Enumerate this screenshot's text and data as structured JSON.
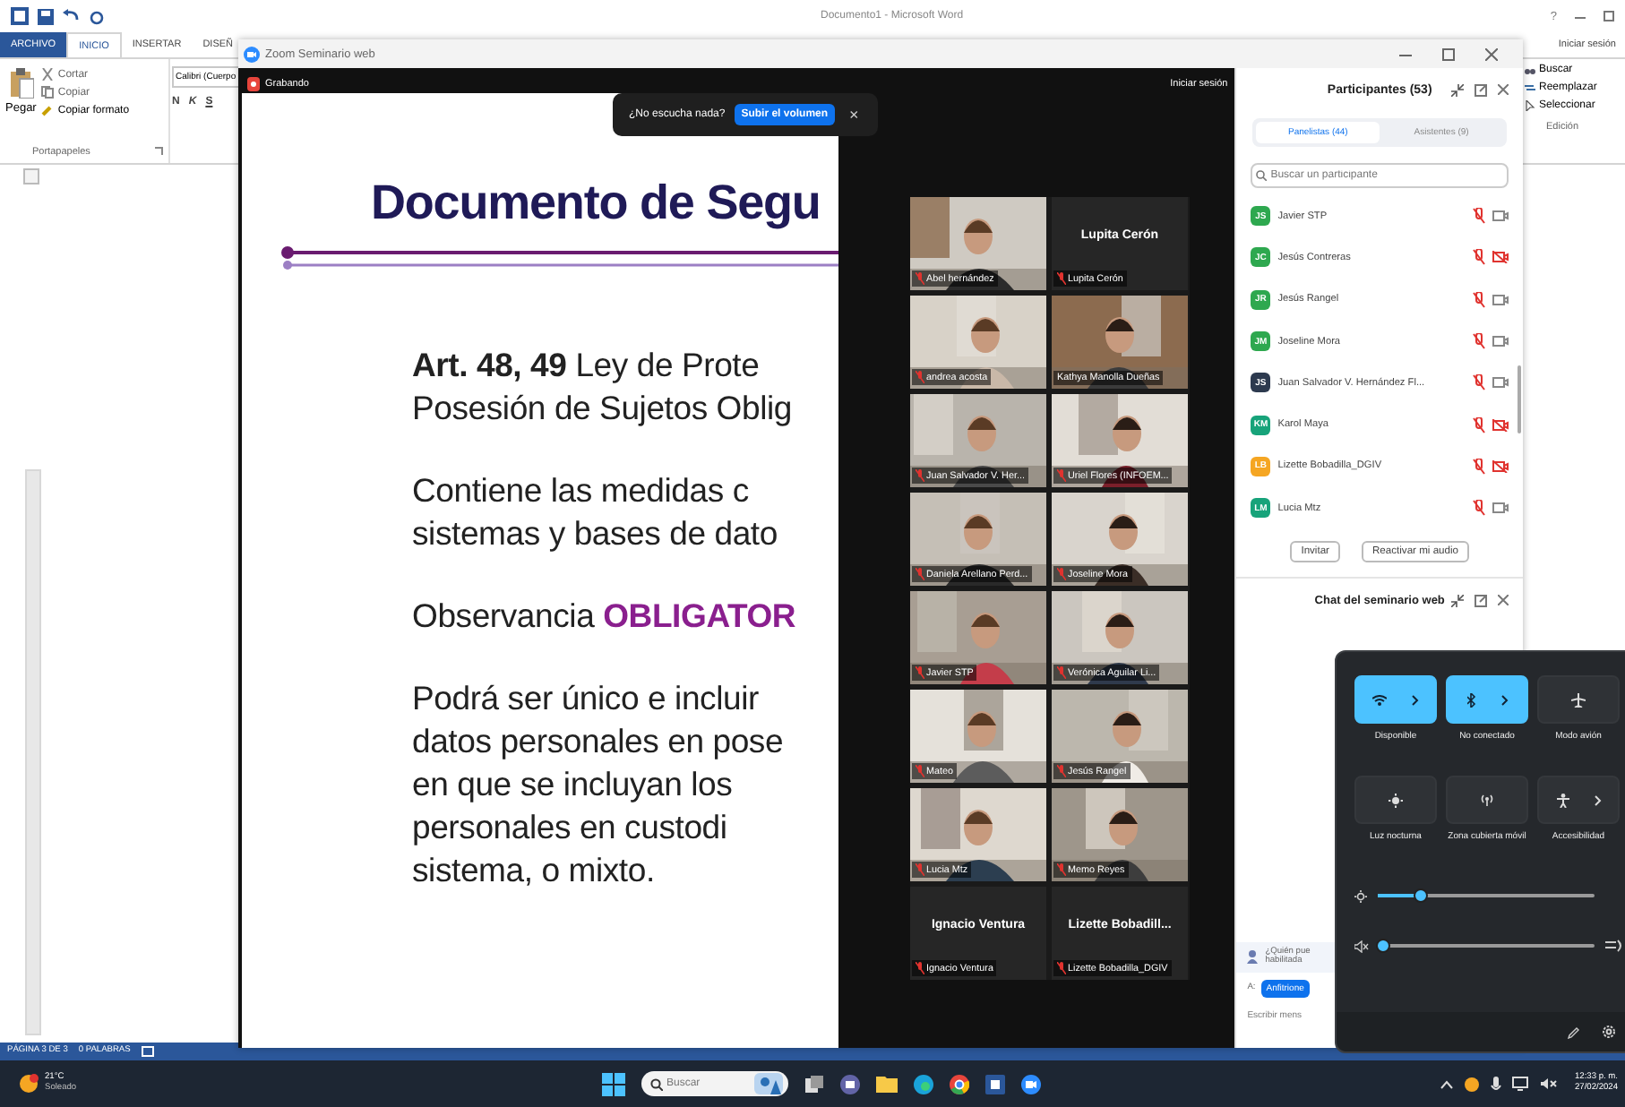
{
  "word": {
    "title": "Documento1 - Microsoft Word",
    "help": "?",
    "tabs": [
      {
        "label": "ARCHIVO",
        "kind": "file",
        "selected": false
      },
      {
        "label": "INICIO",
        "kind": "tab",
        "selected": true
      },
      {
        "label": "INSERTAR",
        "kind": "tab",
        "selected": false
      },
      {
        "label": "DISEÑ",
        "kind": "tab",
        "selected": false
      }
    ],
    "clipboard": {
      "paste": "Pegar",
      "cut": "Cortar",
      "copy": "Copiar",
      "format": "Copiar formato",
      "group": "Portapapeles"
    },
    "font_box": "Calibri (Cuerpo",
    "format_buttons": [
      "N",
      "K",
      "S"
    ],
    "sign_in": "Iniciar sesión",
    "editing": {
      "items": [
        "Buscar",
        "Reemplazar",
        "Seleccionar"
      ],
      "group": "Edición"
    },
    "status": [
      "PÁGINA 3 DE 3",
      "0 PALABRAS"
    ]
  },
  "zoom": {
    "title": "Zoom Seminario web",
    "recording": "Grabando",
    "sign_in": "Iniciar sesión",
    "prompt": {
      "text": "¿No escucha nada?",
      "button": "Subir el volumen",
      "close": "×"
    },
    "slide": {
      "title": "Documento de Segu",
      "paragraphs": [
        {
          "lines": [
            "**Art. 48, 49** Ley de Prote",
            "Posesión de Sujetos Oblig"
          ]
        },
        {
          "lines": [
            "Contiene las medidas c",
            "sistemas y bases de dato"
          ]
        },
        {
          "lines": [
            "Observancia **OBLIGATOR**"
          ]
        },
        {
          "lines": [
            "Podrá ser único e incluir",
            "datos personales en pose",
            "en que se incluyan los",
            "personales en custodi",
            "sistema, o mixto."
          ]
        }
      ]
    },
    "videos": [
      {
        "name": "Abel hernández",
        "kind": "video",
        "muted": true,
        "speaking": false
      },
      {
        "name": "Lupita Cerón",
        "display": "Lupita Cerón",
        "kind": "name",
        "muted": true,
        "speaking": false
      },
      {
        "name": "andrea acosta",
        "kind": "video",
        "muted": true,
        "speaking": false
      },
      {
        "name": "Kathya Manolla Dueñas",
        "kind": "video",
        "muted": false,
        "speaking": true
      },
      {
        "name": "Juan Salvador V. Her...",
        "kind": "video",
        "muted": true,
        "speaking": false
      },
      {
        "name": "Uriel Flores (INFOEM...",
        "kind": "video",
        "muted": true,
        "speaking": false
      },
      {
        "name": "Daniela Arellano Perd...",
        "kind": "video",
        "muted": true,
        "speaking": false
      },
      {
        "name": "Joseline Mora",
        "kind": "video",
        "muted": true,
        "speaking": false
      },
      {
        "name": "Javier STP",
        "kind": "video",
        "muted": true,
        "speaking": false
      },
      {
        "name": "Verónica Aguilar Li...",
        "kind": "video",
        "muted": true,
        "speaking": false
      },
      {
        "name": "Mateo",
        "kind": "video",
        "muted": true,
        "speaking": false
      },
      {
        "name": "Jesús Rangel",
        "kind": "video",
        "muted": true,
        "speaking": false
      },
      {
        "name": "Lucia Mtz",
        "kind": "video",
        "muted": true,
        "speaking": false
      },
      {
        "name": "Memo Reyes",
        "kind": "video",
        "muted": true,
        "speaking": false
      },
      {
        "name": "Ignacio Ventura",
        "display": "Ignacio Ventura",
        "kind": "name",
        "muted": true,
        "speaking": false
      },
      {
        "name": "Lizette Bobadilla_DGIV",
        "display": "Lizette Bobadill...",
        "kind": "name",
        "muted": true,
        "speaking": false
      }
    ],
    "participants": {
      "title": "Participantes (53)",
      "tabs": [
        {
          "label": "Panelistas (44)",
          "selected": true
        },
        {
          "label": "Asistentes (9)",
          "selected": false
        }
      ],
      "search": {
        "placeholder": "Buscar un participante"
      },
      "list": [
        {
          "initials": "JS",
          "name": "Javier STP",
          "color": "#2ea84f",
          "muted": true,
          "video_off": false
        },
        {
          "initials": "JC",
          "name": "Jesús Contreras",
          "color": "#2ea84f",
          "muted": true,
          "video_off": true
        },
        {
          "initials": "JR",
          "name": "Jesús Rangel",
          "color": "#2ea84f",
          "muted": true,
          "video_off": false
        },
        {
          "initials": "JM",
          "name": "Joseline Mora",
          "color": "#2ea84f",
          "muted": true,
          "video_off": false
        },
        {
          "initials": "JS",
          "name": "Juan Salvador V. Hernández Fl...",
          "color": "#2d3a4f",
          "muted": true,
          "video_off": false
        },
        {
          "initials": "KM",
          "name": "Karol Maya",
          "color": "#17a37a",
          "muted": true,
          "video_off": true
        },
        {
          "initials": "LB",
          "name": "Lizette Bobadilla_DGIV",
          "color": "#f5a623",
          "muted": true,
          "video_off": true
        },
        {
          "initials": "LM",
          "name": "Lucia Mtz",
          "color": "#17a37a",
          "muted": true,
          "video_off": false
        }
      ],
      "buttons": [
        "Invitar",
        "Reactivar mi audio"
      ]
    },
    "chat": {
      "title": "Chat del seminario web",
      "notice": [
        "¿Quién pue",
        "habilitada"
      ],
      "to_label": "A:",
      "to_button": "Anfitrione",
      "input": {
        "placeholder": "Escribir mens"
      }
    }
  },
  "quick_settings": {
    "tiles": [
      {
        "label": "Disponible",
        "kind": "wifi",
        "on": true,
        "arrow": true
      },
      {
        "label": "No conectado",
        "kind": "bluetooth",
        "on": true,
        "arrow": true
      },
      {
        "label": "Modo avión",
        "kind": "airplane",
        "on": false,
        "arrow": false
      },
      {
        "label": "Luz nocturna",
        "kind": "night",
        "on": false,
        "arrow": false
      },
      {
        "label": "Zona cubierta móvil",
        "kind": "hotspot",
        "on": false,
        "arrow": false
      },
      {
        "label": "Accesibilidad",
        "kind": "accessibility",
        "on": false,
        "arrow": true
      }
    ],
    "sliders": [
      {
        "kind": "brightness",
        "level": 0.2
      },
      {
        "kind": "volume",
        "level": 0.02
      }
    ]
  },
  "taskbar": {
    "weather": {
      "temp": "21°C",
      "text": "Soleado"
    },
    "search": {
      "placeholder": "Buscar"
    },
    "time": "12:33 p. m.",
    "date": "27/02/2024"
  }
}
